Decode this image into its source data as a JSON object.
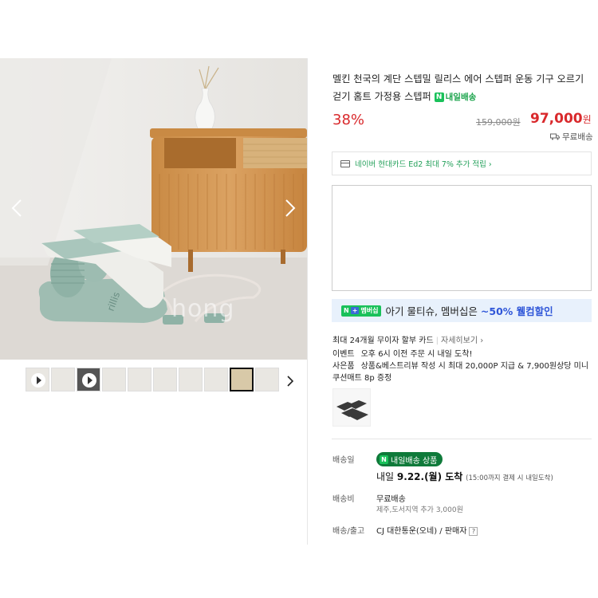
{
  "gallery": {
    "watermark": "hong",
    "thumbnail_count": 10,
    "active_thumbnail_index": 8,
    "video_thumbnail_indices": [
      0,
      2
    ]
  },
  "product": {
    "title": "멜킨 천국의 계단 스텝밀 릴리스 에어 스텝퍼 운동 기구 오르기 걷기 홈트 가정용 스텝퍼",
    "delivery_badge": "내일배송",
    "discount": "38%",
    "original_price": "159,000원",
    "sale_price": "97,000",
    "sale_price_unit": "원",
    "shipping": "무료배송"
  },
  "card_benefit": {
    "text": "네이버 현대카드 Ed2 최대 7% 추가 적립 ›"
  },
  "banner": {
    "pill_n": "N",
    "pill_plus": "+",
    "pill_text": "멤버십",
    "text_prefix": "아기 물티슈, 멤버십은 ",
    "text_highlight": "~50% 웰컴할인"
  },
  "installment": {
    "text": "최대 24개월 무이자 할부 카드",
    "sep": "|",
    "more": "자세히보기 ›"
  },
  "event": {
    "label": "이벤트",
    "text": "오후 6시 이전 주문 시 내일 도착!"
  },
  "gift": {
    "label": "사은품",
    "text": "상품&베스트리뷰 작성 시 최대 20,000P 지급 & 7,900원상당 미니 쿠션매트 8p 증정"
  },
  "delivery": {
    "date_label": "배송일",
    "badge": "내일배송 상품",
    "date_prefix": "내일 ",
    "date_bold": "9.22.(월) 도착",
    "date_note": "(15:00까지 결제 시 내일도착)",
    "fee_label": "배송비",
    "fee_value": "무료배송",
    "fee_note": "제주,도서지역 추가 3,000원",
    "courier_label": "배송/출고",
    "courier_value": "CJ 대한통운(오네) / 판매자",
    "help": "?"
  },
  "colors": {
    "price_red": "#d9292c",
    "naver_green": "#19c15a",
    "banner_bg": "#e8f1fc",
    "banner_highlight": "#2f56d8",
    "benefit_green": "#23a05a"
  }
}
